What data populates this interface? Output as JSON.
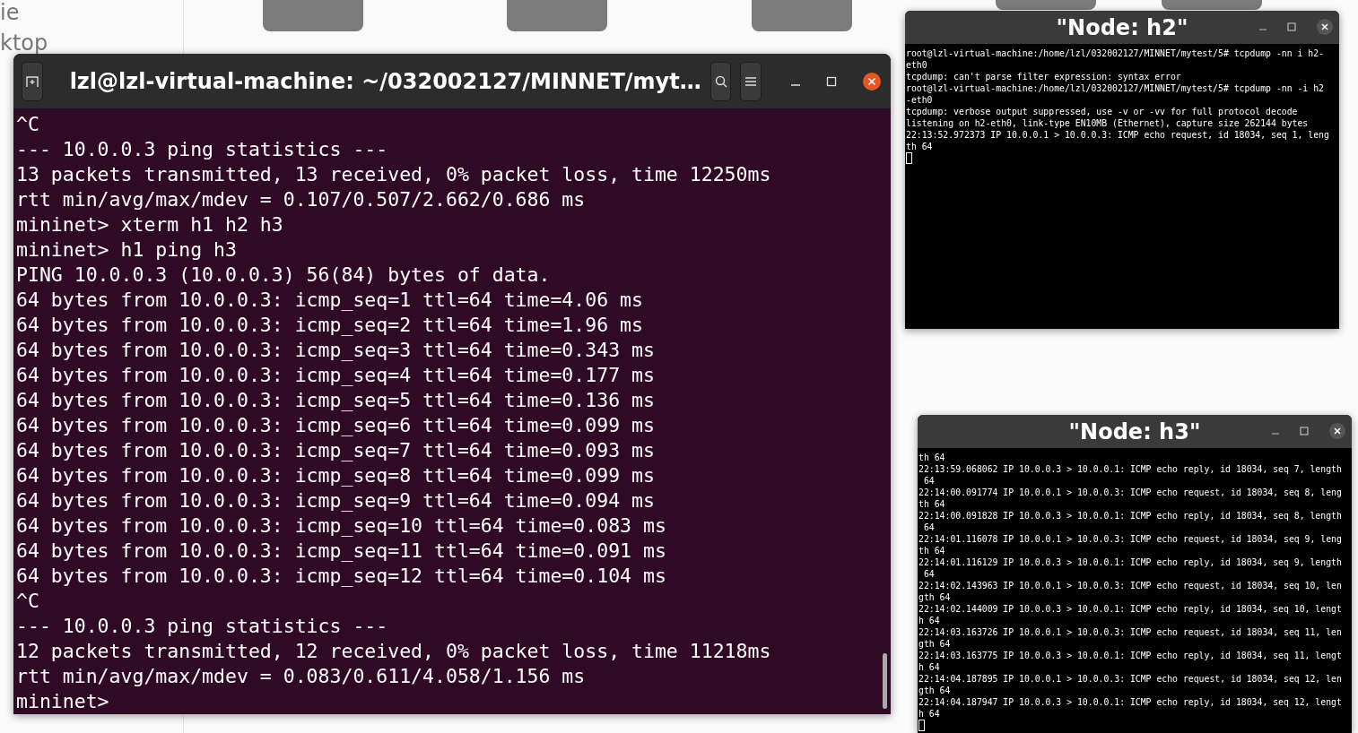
{
  "file_manager": {
    "sidebar_fragments": [
      "ie",
      "ktop"
    ]
  },
  "terminal": {
    "title": "lzl@lzl-virtual-machine: ~/032002127/MINNET/myt…",
    "lines": [
      "^C",
      "--- 10.0.0.3 ping statistics ---",
      "13 packets transmitted, 13 received, 0% packet loss, time 12250ms",
      "rtt min/avg/max/mdev = 0.107/0.507/2.662/0.686 ms",
      "mininet> xterm h1 h2 h3",
      "mininet> h1 ping h3",
      "PING 10.0.0.3 (10.0.0.3) 56(84) bytes of data.",
      "64 bytes from 10.0.0.3: icmp_seq=1 ttl=64 time=4.06 ms",
      "64 bytes from 10.0.0.3: icmp_seq=2 ttl=64 time=1.96 ms",
      "64 bytes from 10.0.0.3: icmp_seq=3 ttl=64 time=0.343 ms",
      "64 bytes from 10.0.0.3: icmp_seq=4 ttl=64 time=0.177 ms",
      "64 bytes from 10.0.0.3: icmp_seq=5 ttl=64 time=0.136 ms",
      "64 bytes from 10.0.0.3: icmp_seq=6 ttl=64 time=0.099 ms",
      "64 bytes from 10.0.0.3: icmp_seq=7 ttl=64 time=0.093 ms",
      "64 bytes from 10.0.0.3: icmp_seq=8 ttl=64 time=0.099 ms",
      "64 bytes from 10.0.0.3: icmp_seq=9 ttl=64 time=0.094 ms",
      "64 bytes from 10.0.0.3: icmp_seq=10 ttl=64 time=0.083 ms",
      "64 bytes from 10.0.0.3: icmp_seq=11 ttl=64 time=0.091 ms",
      "64 bytes from 10.0.0.3: icmp_seq=12 ttl=64 time=0.104 ms",
      "^C",
      "--- 10.0.0.3 ping statistics ---",
      "12 packets transmitted, 12 received, 0% packet loss, time 11218ms",
      "rtt min/avg/max/mdev = 0.083/0.611/4.058/1.156 ms",
      "mininet>"
    ]
  },
  "xterms": [
    {
      "title": "\"Node: h2\"",
      "cursor": true,
      "lines": [
        "root@lzl-virtual-machine:/home/lzl/032002127/MINNET/mytest/5# tcpdump -nn i h2-",
        "eth0",
        "tcpdump: can't parse filter expression: syntax error",
        "root@lzl-virtual-machine:/home/lzl/032002127/MINNET/mytest/5# tcpdump -nn -i h2",
        "-eth0",
        "tcpdump: verbose output suppressed, use -v or -vv for full protocol decode",
        "listening on h2-eth0, link-type EN10MB (Ethernet), capture size 262144 bytes",
        "22:13:52.972373 IP 10.0.0.1 > 10.0.0.3: ICMP echo request, id 18034, seq 1, leng",
        "th 64"
      ]
    },
    {
      "title": "\"Node: h3\"",
      "cursor": true,
      "lines": [
        "th 64",
        "22:13:59.068062 IP 10.0.0.3 > 10.0.0.1: ICMP echo reply, id 18034, seq 7, length",
        " 64",
        "22:14:00.091774 IP 10.0.0.1 > 10.0.0.3: ICMP echo request, id 18034, seq 8, leng",
        "th 64",
        "22:14:00.091828 IP 10.0.0.3 > 10.0.0.1: ICMP echo reply, id 18034, seq 8, length",
        " 64",
        "22:14:01.116078 IP 10.0.0.1 > 10.0.0.3: ICMP echo request, id 18034, seq 9, leng",
        "th 64",
        "22:14:01.116129 IP 10.0.0.3 > 10.0.0.1: ICMP echo reply, id 18034, seq 9, length",
        " 64",
        "22:14:02.143963 IP 10.0.0.1 > 10.0.0.3: ICMP echo request, id 18034, seq 10, len",
        "gth 64",
        "22:14:02.144009 IP 10.0.0.3 > 10.0.0.1: ICMP echo reply, id 18034, seq 10, lengt",
        "h 64",
        "22:14:03.163726 IP 10.0.0.1 > 10.0.0.3: ICMP echo request, id 18034, seq 11, len",
        "gth 64",
        "22:14:03.163775 IP 10.0.0.3 > 10.0.0.1: ICMP echo reply, id 18034, seq 11, lengt",
        "h 64",
        "22:14:04.187895 IP 10.0.0.1 > 10.0.0.3: ICMP echo request, id 18034, seq 12, len",
        "gth 64",
        "22:14:04.187947 IP 10.0.0.3 > 10.0.0.1: ICMP echo reply, id 18034, seq 12, lengt",
        "h 64"
      ]
    }
  ]
}
